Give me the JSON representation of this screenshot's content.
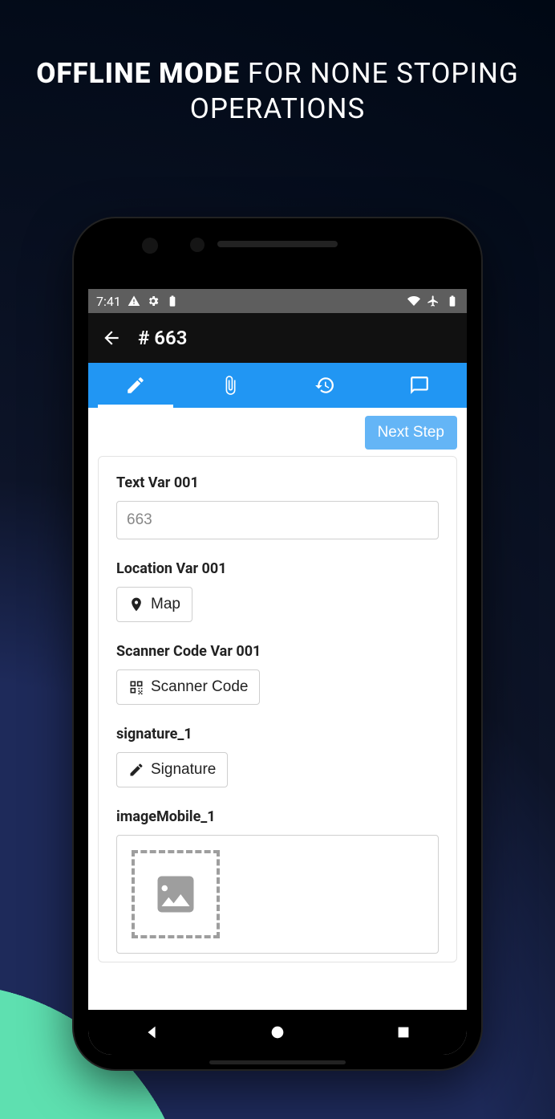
{
  "marketing": {
    "bold": "OFFLINE MODE",
    "light1": " FOR NONE STOPING",
    "light2": "OPERATIONS"
  },
  "statusbar": {
    "time": "7:41"
  },
  "header": {
    "title": "# 663"
  },
  "tabs": {
    "edit": "edit",
    "attach": "attach",
    "history": "history",
    "chat": "chat"
  },
  "actions": {
    "next": "Next Step"
  },
  "fields": {
    "text": {
      "label": "Text Var 001",
      "value": "663"
    },
    "location": {
      "label": "Location Var 001",
      "button": "Map"
    },
    "scanner": {
      "label": "Scanner Code Var 001",
      "button": "Scanner Code"
    },
    "signature": {
      "label": "signature_1",
      "button": "Signature"
    },
    "image": {
      "label": "imageMobile_1"
    }
  }
}
